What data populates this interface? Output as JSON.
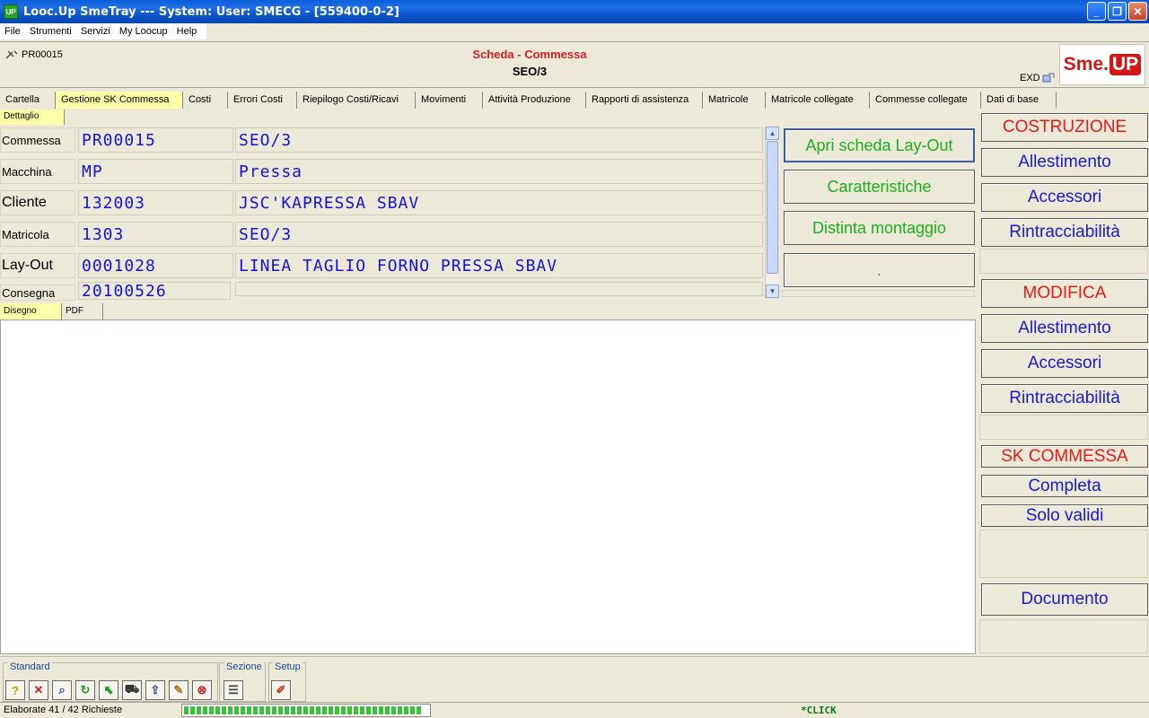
{
  "window": {
    "title": "Looc.Up SmeTray --- System: User: SMECG - [559400-0-2]",
    "icon_text": "UP"
  },
  "menu": [
    "File",
    "Strumenti",
    "Servizi",
    "My Loocup",
    "Help"
  ],
  "header": {
    "code": "PR00015",
    "title": "Scheda - Commessa",
    "subtitle": "SEO/3",
    "exd": "EXD",
    "logo_left": "Sme.",
    "logo_right": "UP"
  },
  "tabs": [
    "Cartella",
    "Gestione SK Commessa",
    "Costi",
    "Errori Costi",
    "Riepilogo Costi/Ricavi",
    "Movimenti",
    "Attività Produzione",
    "Rapporti di assistenza",
    "Matricole",
    "Matricole collegate",
    "Commesse collegate",
    "Dati di base"
  ],
  "subtab": "Dettaglio",
  "fields": [
    {
      "label": "Commessa",
      "code": "PR00015",
      "desc": "SEO/3"
    },
    {
      "label": "Macchina",
      "code": "MP",
      "desc": "Pressa"
    },
    {
      "label": "Cliente",
      "code": "132003",
      "desc": "JSC'KAPRESSA SBAV"
    },
    {
      "label": "Matricola",
      "code": "1303",
      "desc": "SEO/3"
    },
    {
      "label": "Lay-Out",
      "code": "0001028",
      "desc": "LINEA TAGLIO FORNO PRESSA SBAV"
    },
    {
      "label": "Consegna",
      "code": "20100526",
      "desc": ""
    }
  ],
  "actions": [
    "Apri scheda Lay-Out",
    "Caratteristiche",
    "Distinta montaggio",
    "."
  ],
  "lower_tabs": [
    "Disegno",
    "PDF"
  ],
  "right_panel": {
    "costruzione": "COSTRUZIONE",
    "allestimento1": "Allestimento",
    "accessori1": "Accessori",
    "rintracciabilita1": "Rintracciabilità",
    "modifica": "MODIFICA",
    "allestimento2": "Allestimento",
    "accessori2": "Accessori",
    "rintracciabilita2": "Rintracciabilità",
    "sk_commessa": "SK COMMESSA",
    "completa": "Completa",
    "solo_validi": "Solo validi",
    "documento": "Documento"
  },
  "toolbar": {
    "standard": "Standard",
    "sezione": "Sezione",
    "setup": "Setup"
  },
  "status": {
    "text": "Elaborate 41 / 42 Richieste",
    "progress": 0.976,
    "click": "*CLICK"
  }
}
